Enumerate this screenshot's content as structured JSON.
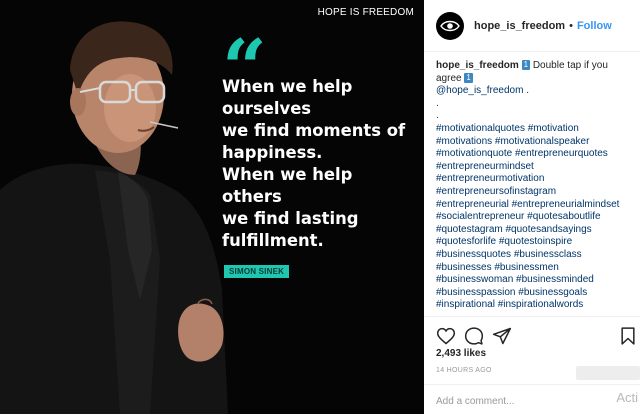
{
  "post_image": {
    "brand": "HOPE IS FREEDOM",
    "quote_mark": "“",
    "quote_lines": [
      "When we help",
      "ourselves",
      "we find moments of",
      "happiness.",
      "When we help",
      "others",
      "we find lasting",
      "fulfillment."
    ],
    "author": "SIMON SINEK",
    "accent_color": "#1ec8b0"
  },
  "header": {
    "username": "hope_is_freedom",
    "separator": "•",
    "follow_label": "Follow"
  },
  "caption": {
    "username": "hope_is_freedom",
    "emoji_1": "1",
    "text_1": "Double tap if you",
    "text_2": "agree",
    "emoji_2": "1",
    "mention": "@hope_is_freedom",
    "mention_suffix": " .",
    "dot": ".",
    "hashtag_lines": [
      "#motivationalquotes #motivation",
      "#motivations #motivationalspeaker",
      "#motivationquote #entrepreneurquotes",
      "#entrepreneurmindset",
      "#entrepreneurmotivation",
      "#entrepreneursofinstagram",
      "#entrepreneurial #entrepreneurialmindset",
      "#socialentrepreneur #quotesaboutlife",
      "#quotestagram #quotesandsayings",
      "#quotesforlife #quotestoinspire",
      "#businessquotes #businessclass",
      "#businesses #businessmen",
      "#businesswoman #businessminded",
      "#businesspassion #businessgoals",
      "#inspirational #inspirationalwords"
    ]
  },
  "actions": {
    "icons": [
      "heart-icon",
      "comment-icon",
      "share-icon",
      "bookmark-icon"
    ]
  },
  "likes": "2,493 likes",
  "timestamp": "14 HOURS AGO",
  "comment": {
    "placeholder": "Add a comment..."
  },
  "watermark": "Acti",
  "colors": {
    "link_blue": "#3897f0",
    "hashtag": "#003569",
    "text": "#262626",
    "muted": "#999999",
    "emoji_bg": "#3b88c3"
  }
}
